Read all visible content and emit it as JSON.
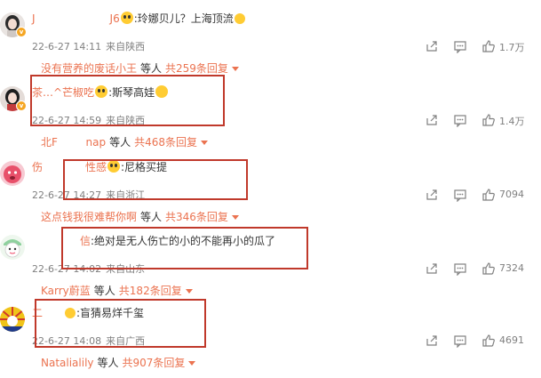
{
  "comments": [
    {
      "username": "J　　　　　　　J6",
      "text": ":玲娜贝儿？上海顶流",
      "time": "22-6-27 14:11",
      "location": "来自陕西",
      "likes": "1.7万",
      "reply_user": "没有营养的废话小王",
      "reply_sep": "等人",
      "reply_count": "共259条回复",
      "avatar_color": "#d9d3cf",
      "avatar_icon": "girl-portrait"
    },
    {
      "username": "茶…^芒椒吃",
      "text": ":斯琴高娃",
      "time": "22-6-27 14:59",
      "location": "来自陕西",
      "likes": "1.4万",
      "reply_user": "北F　 　 nap",
      "reply_sep": "等人",
      "reply_count": "共468条回复",
      "avatar_color": "#c9b7b0",
      "avatar_icon": "girl-portrait"
    },
    {
      "username": "伤　　　　性感",
      "text": ":尼格买提",
      "time": "22-6-27 14:27",
      "location": "来自浙江",
      "likes": "7094",
      "reply_user": "这点钱我很难帮你啊",
      "reply_sep": "等人",
      "reply_count": "共346条回复",
      "avatar_color": "#e8506a",
      "avatar_icon": "pink-character"
    },
    {
      "username": "信",
      "text": ":绝对是无人伤亡的小的不能再小的瓜了",
      "time": "22-6-27 14:02",
      "location": "来自山东",
      "likes": "7324",
      "reply_user": "Karry蔚蓝",
      "reply_sep": "等人",
      "reply_count": "共182条回复",
      "avatar_color": "#8fd19e",
      "avatar_icon": "cartoon-face"
    },
    {
      "username": "二　　",
      "text": ":盲猜易烊千玺",
      "time": "22-6-27 14:08",
      "location": "来自广西",
      "likes": "4691",
      "reply_user": "Natalialily",
      "reply_sep": "等人",
      "reply_count": "共907条回复",
      "avatar_color": "#f0c419",
      "avatar_icon": "sunburst-flag"
    }
  ],
  "colors": {
    "username": "#eb7350",
    "meta": "#808080",
    "highlight": "#c0392b"
  }
}
